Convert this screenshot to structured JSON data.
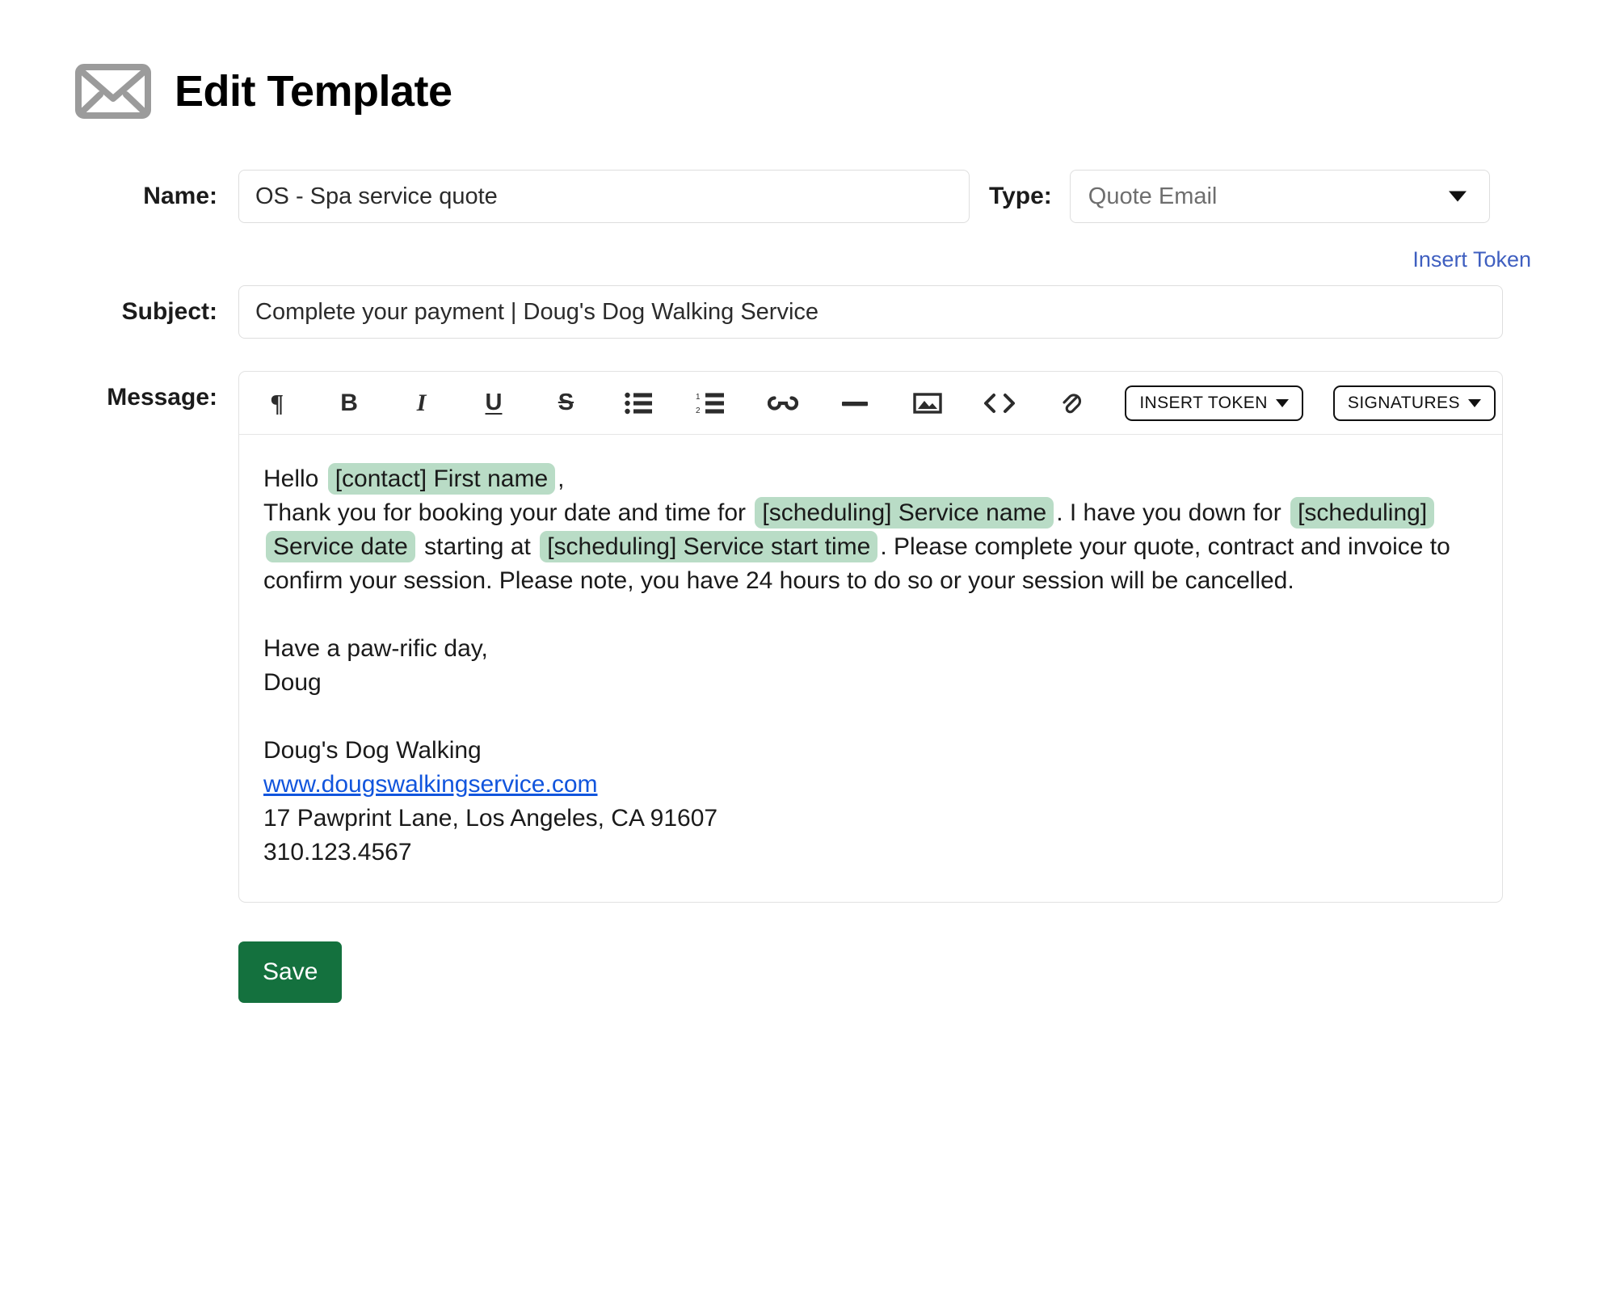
{
  "header": {
    "icon": "envelope-icon",
    "title": "Edit Template"
  },
  "form": {
    "name": {
      "label": "Name:",
      "value": "OS - Spa service quote",
      "placeholder": ""
    },
    "type": {
      "label": "Type:",
      "value": "Quote Email",
      "caret_icon": "chevron-down-icon"
    },
    "insert_token_link": "Insert Token",
    "subject": {
      "label": "Subject:",
      "value": "Complete your payment | Doug's Dog Walking Service",
      "placeholder": ""
    },
    "message": {
      "label": "Message:"
    }
  },
  "toolbar": {
    "icons": [
      {
        "name": "paragraph-icon",
        "glyph": "¶",
        "title": "Paragraph"
      },
      {
        "name": "bold-icon",
        "glyph": "B",
        "title": "Bold"
      },
      {
        "name": "italic-icon",
        "glyph": "I",
        "title": "Italic"
      },
      {
        "name": "underline-icon",
        "glyph": "U",
        "title": "Underline"
      },
      {
        "name": "strikethrough-icon",
        "glyph": "S",
        "title": "Strikethrough"
      },
      {
        "name": "bullet-list-icon",
        "glyph": "",
        "title": "Bulleted list"
      },
      {
        "name": "numbered-list-icon",
        "glyph": "",
        "title": "Numbered list"
      },
      {
        "name": "link-icon",
        "glyph": "",
        "title": "Insert link"
      },
      {
        "name": "horizontal-rule-icon",
        "glyph": "",
        "title": "Horizontal rule"
      },
      {
        "name": "image-icon",
        "glyph": "",
        "title": "Insert image"
      },
      {
        "name": "code-icon",
        "glyph": "<>",
        "title": "Source code"
      },
      {
        "name": "attachment-icon",
        "glyph": "",
        "title": "Attach file"
      }
    ],
    "insert_token_button": "INSERT TOKEN",
    "signatures_button": "SIGNATURES"
  },
  "message_body": {
    "line1_prefix": "Hello",
    "token_first_name": "[contact] First name",
    "line1_suffix": ",",
    "line2_a": "Thank you for booking your date and time for",
    "token_service_name": "[scheduling] Service name",
    "line2_b": ". I have you down for",
    "token_service_date": "[scheduling] Service date",
    "line2_c": "starting at",
    "token_service_start_time": "[scheduling] Service start time",
    "line2_d": ". Please complete your quote, contract and invoice to confirm your session. Please note, you have 24 hours to do so or your session will be cancelled.",
    "signoff": "Have a paw-rific day,",
    "signer": "Doug",
    "company": "Doug's Dog Walking",
    "website": "www.dougswalkingservice.com",
    "address": "17 Pawprint Lane, Los Angeles, CA 91607",
    "phone": "310.123.4567"
  },
  "actions": {
    "save_label": "Save"
  },
  "colors": {
    "token_highlight": "#b9dcc6",
    "link_blue": "#3f5fc0",
    "body_link_blue": "#1155dd",
    "save_green": "#14713e",
    "border_gray": "#dedede"
  }
}
